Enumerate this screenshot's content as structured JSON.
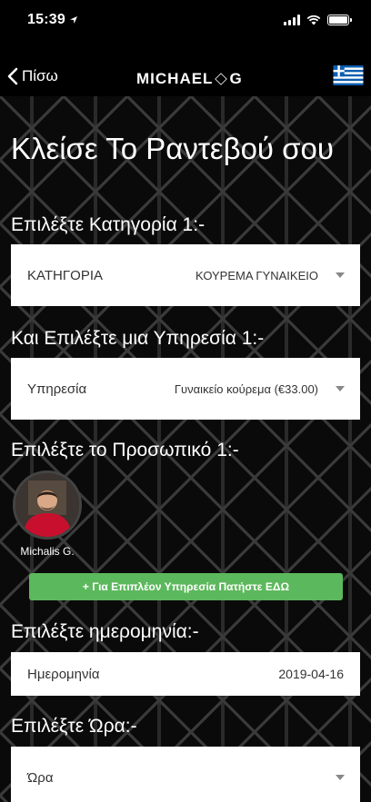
{
  "status": {
    "time": "15:39"
  },
  "nav": {
    "back_label": "Πίσω",
    "logo_left": "MICHAEL",
    "logo_right": "G"
  },
  "title": "Κλείσε Το Ραντεβού σου",
  "category": {
    "section_label": "Επιλέξτε Κατηγορία 1:-",
    "field_label": "ΚΑΤΗΓΟΡΙΑ",
    "value": "ΚΟΥΡΕΜΑ ΓΥΝΑΙΚΕΙΟ"
  },
  "service": {
    "section_label": "Και Επιλέξτε μια Υπηρεσία 1:-",
    "field_label": "Υπηρεσία",
    "value": "Γυναικείο κούρεμα (€33.00)"
  },
  "staff": {
    "section_label": "Επιλέξτε το Προσωπικό 1:-",
    "members": [
      {
        "name": "Michalis G."
      }
    ]
  },
  "more_services_button": "+ Για Επιπλέον Υπηρεσία Πατήστε ΕΔΩ",
  "date": {
    "section_label": "Επιλέξτε ημερομηνία:-",
    "field_label": "Ημερομηνία",
    "value": "2019-04-16"
  },
  "time": {
    "section_label": "Επιλέξτε Ώρα:-",
    "field_label": "Ώρα"
  },
  "colors": {
    "accent_green": "#5cb85c",
    "flag_blue": "#0D5EAF"
  }
}
